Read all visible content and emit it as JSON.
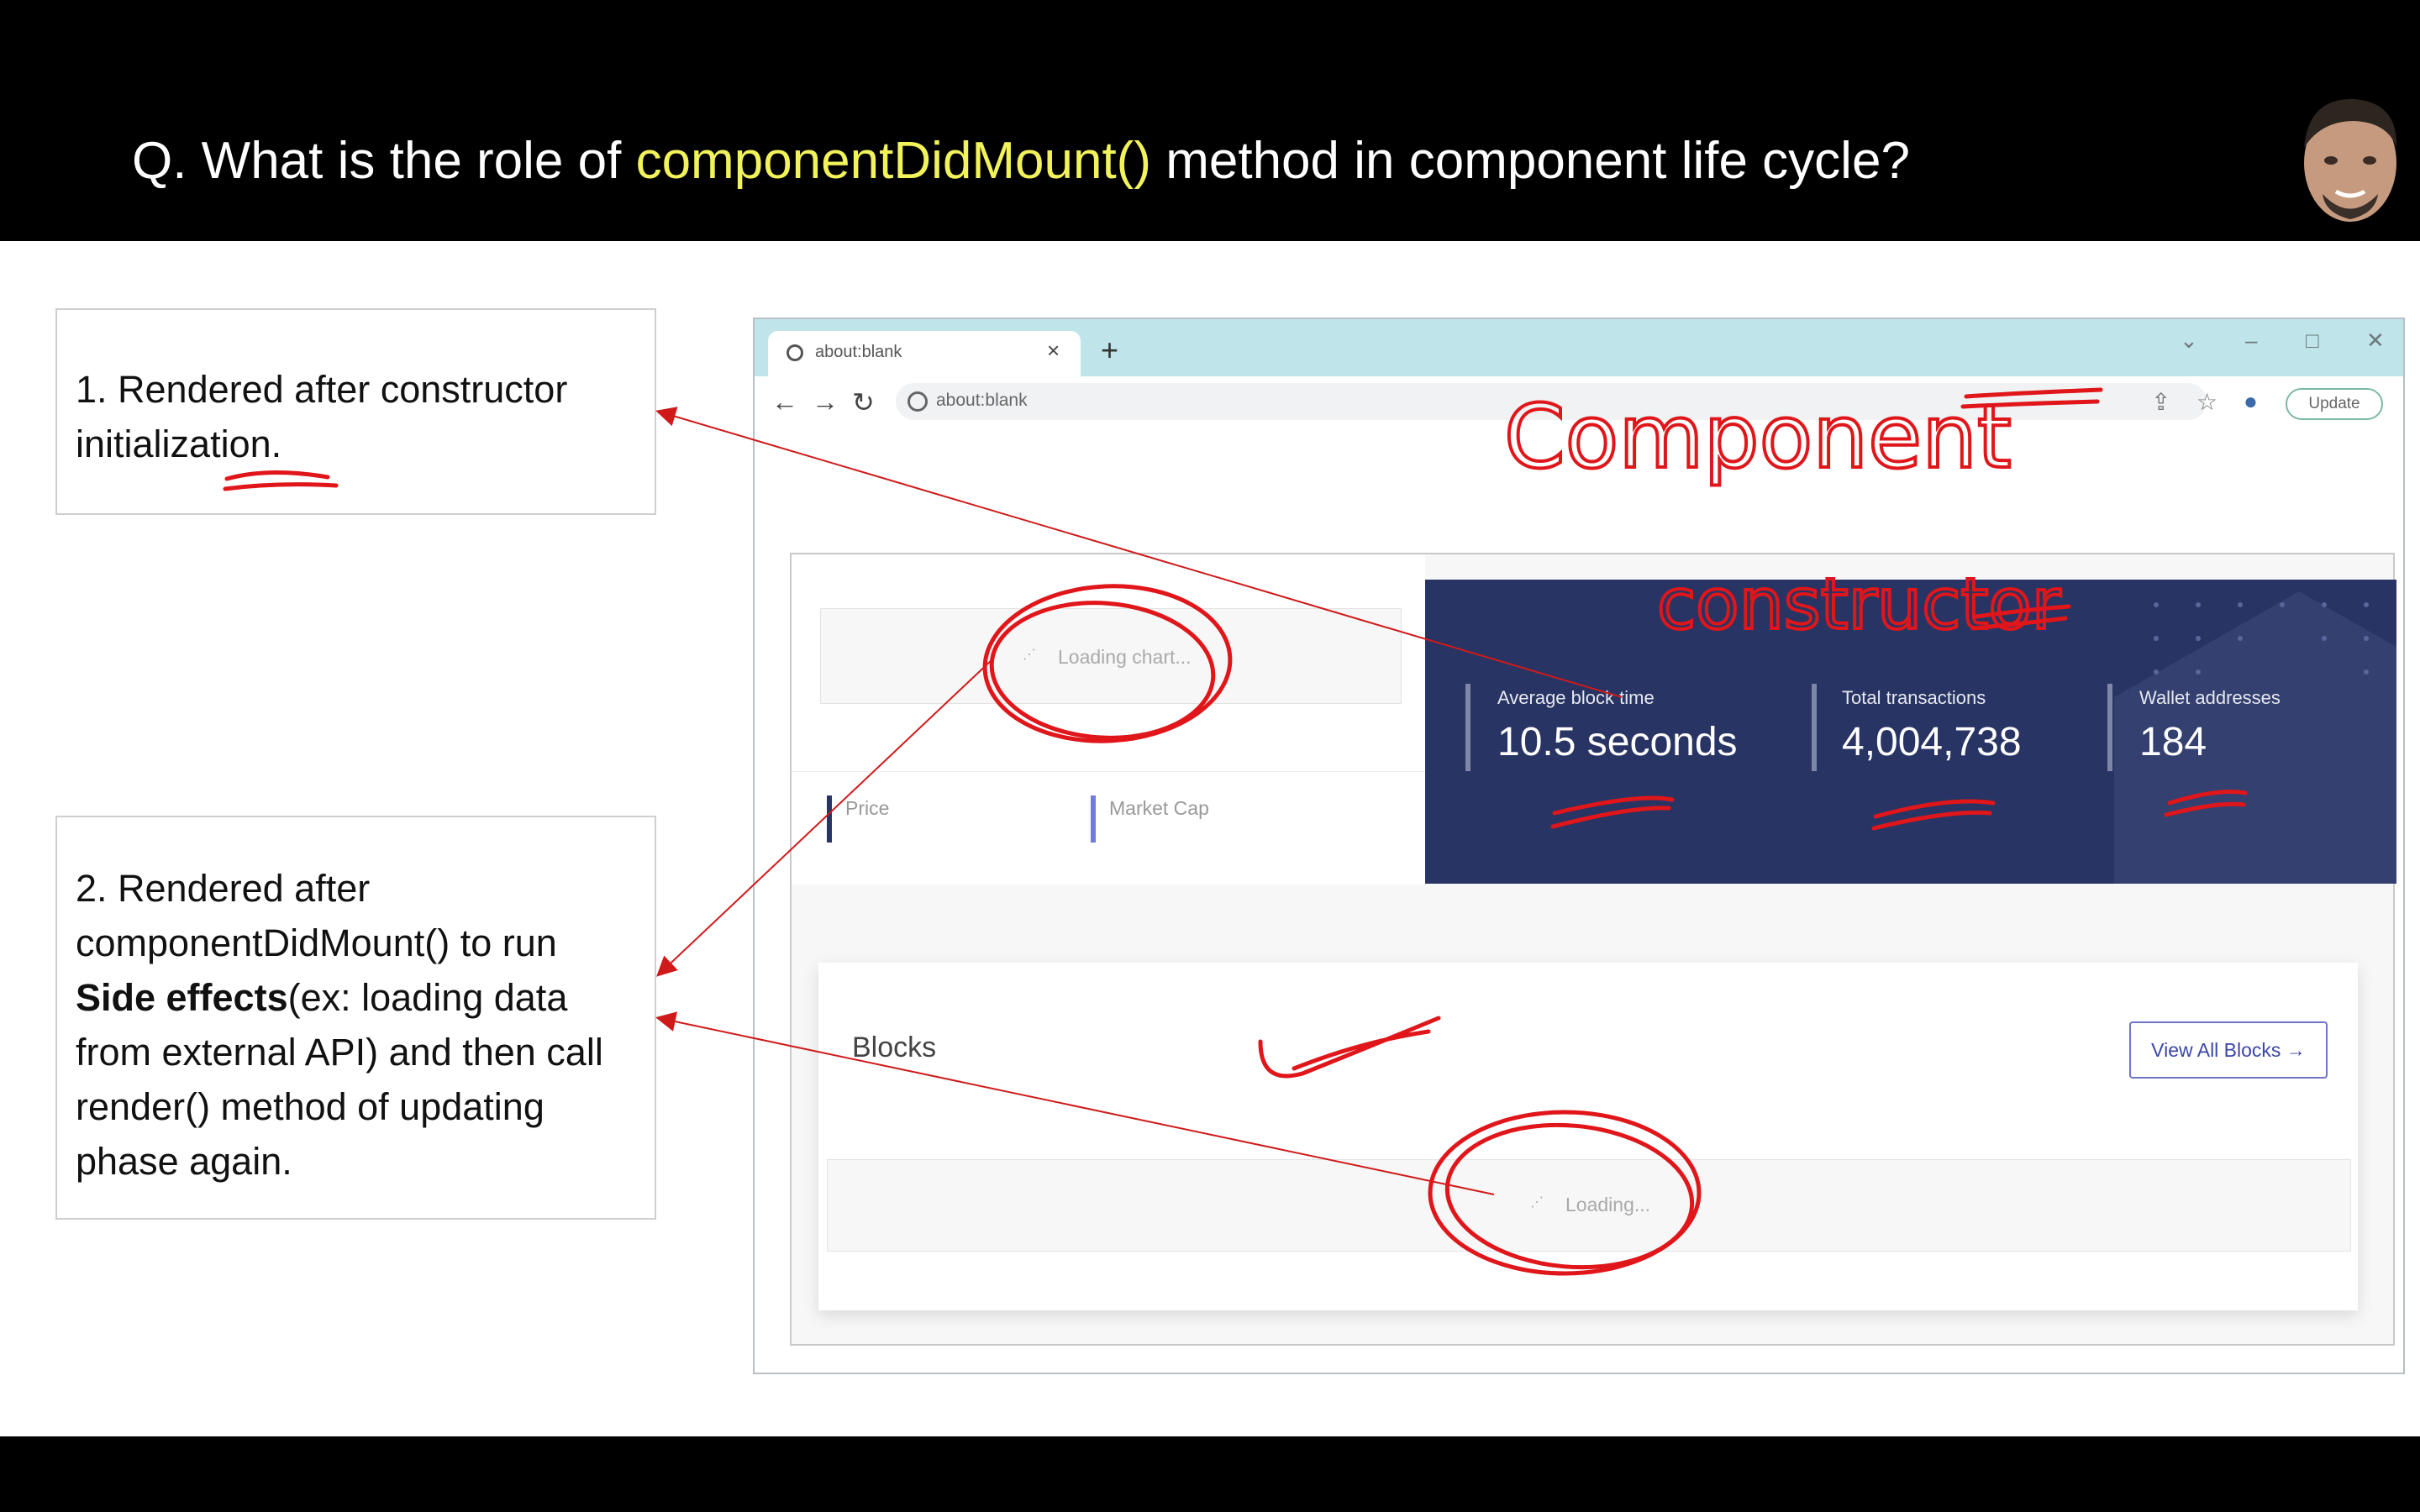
{
  "slide": {
    "question_prefix": "Q. What is the role of ",
    "question_highlight": "componentDidMount()",
    "question_suffix": " method in component life cycle?",
    "highlight_color": "#f2f25a"
  },
  "notes": {
    "note1_text": "1. Rendered after constructor initialization.",
    "note2_line1": "2. Rendered after componentDidMount() to run ",
    "note2_bold": "Side effects",
    "note2_line2": "(ex: loading data from external API) and then call render() method of updating phase again."
  },
  "browser": {
    "tab_title": "about:blank",
    "url": "about:blank",
    "new_tab_icon": "+",
    "tab_close_icon": "×",
    "update_label": "Update",
    "minimize": "–",
    "maximize": "□",
    "close": "✕",
    "chevron": "⌄",
    "back": "←",
    "forward": "→",
    "reload": "↻",
    "share_icon": "⇪",
    "star_icon": "☆",
    "profile_icon": "●",
    "menu_icon": "⋮"
  },
  "page": {
    "chart_loading": "Loading chart...",
    "price_label": "Price",
    "market_cap_label": "Market Cap",
    "stats": [
      {
        "label": "Average block time",
        "value": "10.5 seconds"
      },
      {
        "label": "Total transactions",
        "value": "4,004,738"
      },
      {
        "label": "Wallet addresses",
        "value": "184"
      }
    ],
    "blocks_title": "Blocks",
    "view_all_label": "View All Blocks →",
    "blocks_loading": "Loading..."
  },
  "annotations": {
    "component_text": "Component",
    "constructor_text": "constructor",
    "ink_color": "#e0161a"
  }
}
